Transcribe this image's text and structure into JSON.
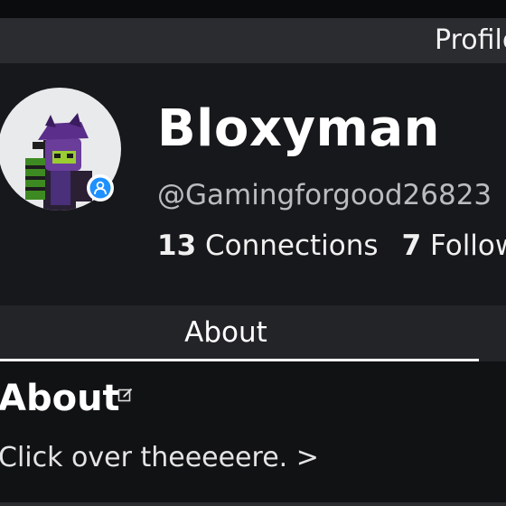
{
  "header": {
    "title": "Profile"
  },
  "profile": {
    "display_name": "Bloxyman",
    "username": "@Gamingforgood26823",
    "connections_count": "13",
    "connections_label": "Connections",
    "followers_count": "7",
    "followers_label": "Followers",
    "status_icon": "person-icon",
    "badge_color": "#1e90ff"
  },
  "tabs": [
    {
      "label": "About",
      "selected": true
    }
  ],
  "about": {
    "heading": "About",
    "edit_icon": "edit-icon",
    "body": "Click over theeeeere. >"
  }
}
